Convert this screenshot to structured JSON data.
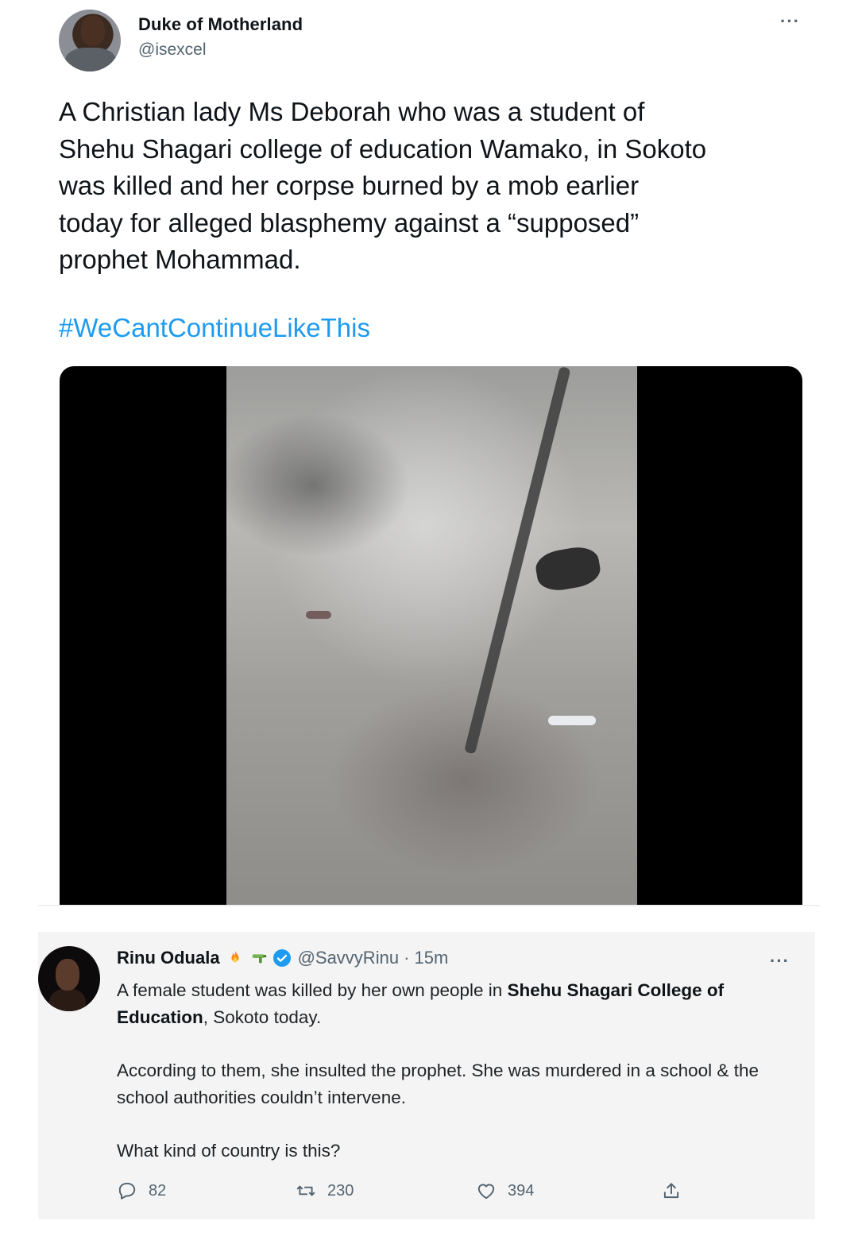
{
  "tweet": {
    "author_name": "Duke of Motherland",
    "author_handle": "@isexcel",
    "more_label": "···",
    "text_lines": [
      "A Christian lady Ms Deborah who was a student of",
      "Shehu Shagari college of education Wamako, in Sokoto",
      "was killed and her corpse burned by a mob earlier",
      "today for alleged blasphemy against a “supposed”",
      "prophet Mohammad."
    ],
    "hashtag": "#WeCantContinueLikeThis"
  },
  "quoted": {
    "author_name": "Rinu Oduala",
    "author_handle": "@SavvyRinu",
    "time": "· 15m",
    "more_label": "···",
    "para1_pre": "A female student was killed by her own people in ",
    "para1_bold": "Shehu Shagari College of Education",
    "para1_post": ", Sokoto today.",
    "para2": "According to them, she insulted the prophet. She was murdered in a school & the school authorities couldn’t intervene.",
    "para3": "What kind of country is this?",
    "replies": "82",
    "retweets": "230",
    "likes": "394"
  },
  "icons": {
    "reply": "reply-icon",
    "retweet": "retweet-icon",
    "like": "heart-icon",
    "share": "share-icon",
    "verified": "verified-badge-icon",
    "emoji": "fire-and-water-gun-emoji"
  },
  "colors": {
    "hashtag": "#1d9bf0",
    "verified": "#1d9bf0",
    "secondary_text": "#536471"
  }
}
